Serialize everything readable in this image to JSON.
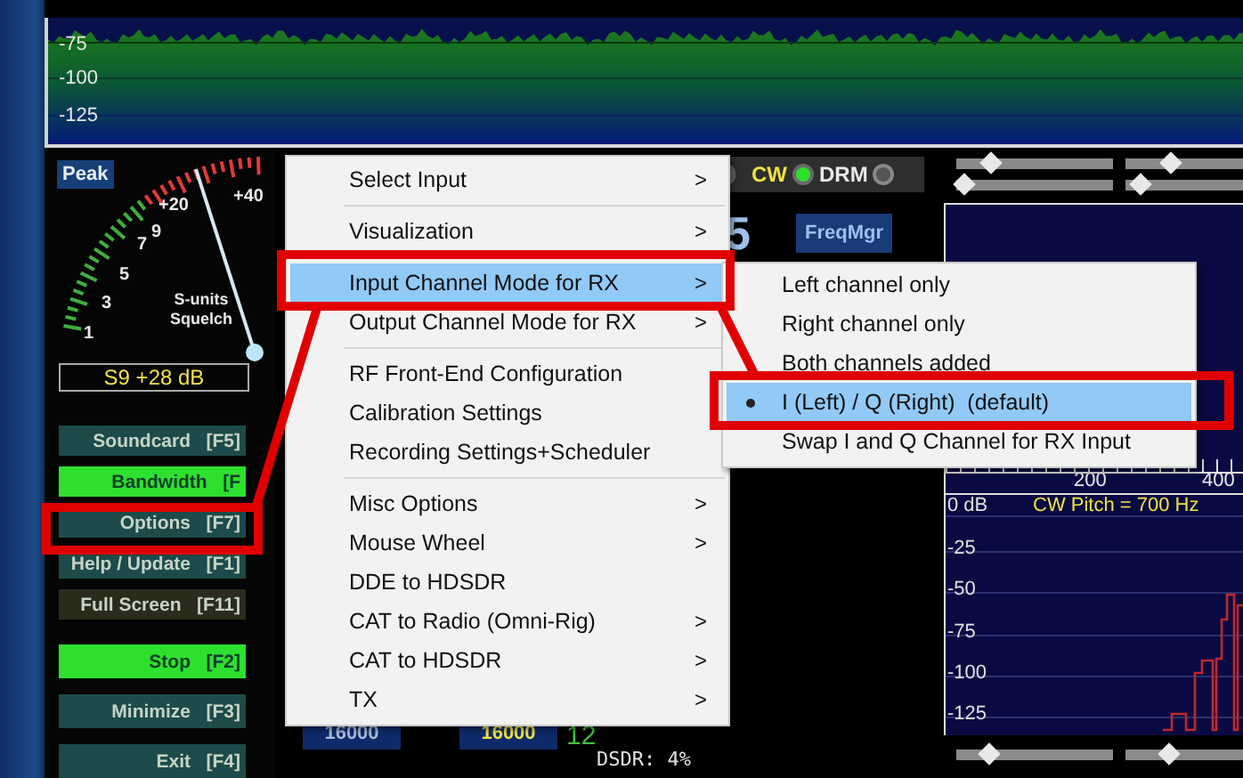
{
  "spectrum": {
    "ticks": [
      "-75",
      "-100",
      "-125"
    ]
  },
  "meter": {
    "peak": "Peak",
    "scale": [
      "1",
      "3",
      "5",
      "7",
      "9",
      "+20",
      "+40"
    ],
    "caption": [
      "S-units",
      "Squelch"
    ],
    "reading": "S9 +28 dB"
  },
  "buttons": [
    {
      "label": "Soundcard",
      "key": "[F5]",
      "color": "#1d4a4a"
    },
    {
      "label": "Bandwidth",
      "key": "[F",
      "color": "#2ee02e"
    },
    {
      "label": "Options",
      "key": "[F7]",
      "color": "#1d4a4a"
    },
    {
      "label": "Help / Update",
      "key": "[F1]",
      "color": "#1d4a4a"
    },
    {
      "label": "Full Screen",
      "key": "[F11]",
      "color": "#2b2b1c"
    }
  ],
  "control_buttons": [
    {
      "label": "Stop",
      "key": "[F2]",
      "color": "#2ee02e"
    },
    {
      "label": "Minimize",
      "key": "[F3]",
      "color": "#1d4a4a"
    },
    {
      "label": "Exit",
      "key": "[F4]",
      "color": "#1d4a4a"
    }
  ],
  "modes": [
    {
      "label": "CW",
      "on": true
    },
    {
      "label": "DRM",
      "on": false
    }
  ],
  "frequency_digit": "5",
  "freq_manager": "FreqMgr",
  "bandwidth_boxes": [
    "16000",
    "16000"
  ],
  "big_readout": "12",
  "cpu_load": "DSDR: 4%",
  "sliders_top": [
    {
      "level": 0.22
    },
    {
      "level": 0.38
    },
    {
      "level": 0.04
    },
    {
      "level": 0.12
    }
  ],
  "audio_panel": {
    "x_ticks": [
      "200",
      "400"
    ],
    "y_ticks": [
      "0 dB",
      "-25",
      "-50",
      "-75",
      "-100",
      "-125"
    ],
    "pitch": "CW Pitch = 700 Hz"
  },
  "sliders_bottom": [
    {
      "level": 0.2
    },
    {
      "level": 0.36
    }
  ],
  "menu": {
    "sections": [
      [
        {
          "label": "Select Input",
          "submenu": true,
          "selected": false
        }
      ],
      [
        {
          "label": "Visualization",
          "submenu": true,
          "selected": false
        }
      ],
      [
        {
          "label": "Input Channel Mode for RX",
          "submenu": true,
          "selected": true
        },
        {
          "label": "Output Channel Mode for RX",
          "submenu": true,
          "selected": false
        }
      ],
      [
        {
          "label": "RF Front-End Configuration",
          "submenu": false,
          "selected": false
        },
        {
          "label": "Calibration Settings",
          "submenu": false,
          "selected": false
        },
        {
          "label": "Recording Settings+Scheduler",
          "submenu": false,
          "selected": false
        }
      ],
      [
        {
          "label": "Misc Options",
          "submenu": true,
          "selected": false
        },
        {
          "label": "Mouse Wheel",
          "submenu": true,
          "selected": false
        },
        {
          "label": "DDE to HDSDR",
          "submenu": false,
          "selected": false
        },
        {
          "label": "CAT to Radio (Omni-Rig)",
          "submenu": true,
          "selected": false
        },
        {
          "label": "CAT to HDSDR",
          "submenu": true,
          "selected": false
        },
        {
          "label": "TX",
          "submenu": true,
          "selected": false
        }
      ]
    ],
    "arrow": ">"
  },
  "submenu": {
    "items": [
      {
        "label": "Left channel only",
        "checked": false,
        "selected": false
      },
      {
        "label": "Right channel only",
        "checked": false,
        "selected": false
      },
      {
        "label": "Both channels added",
        "checked": false,
        "selected": false
      },
      {
        "label": "I (Left) / Q (Right)  (default)",
        "checked": true,
        "selected": true
      },
      {
        "label": "Swap I and Q Channel for RX Input",
        "checked": false,
        "selected": false
      }
    ]
  }
}
